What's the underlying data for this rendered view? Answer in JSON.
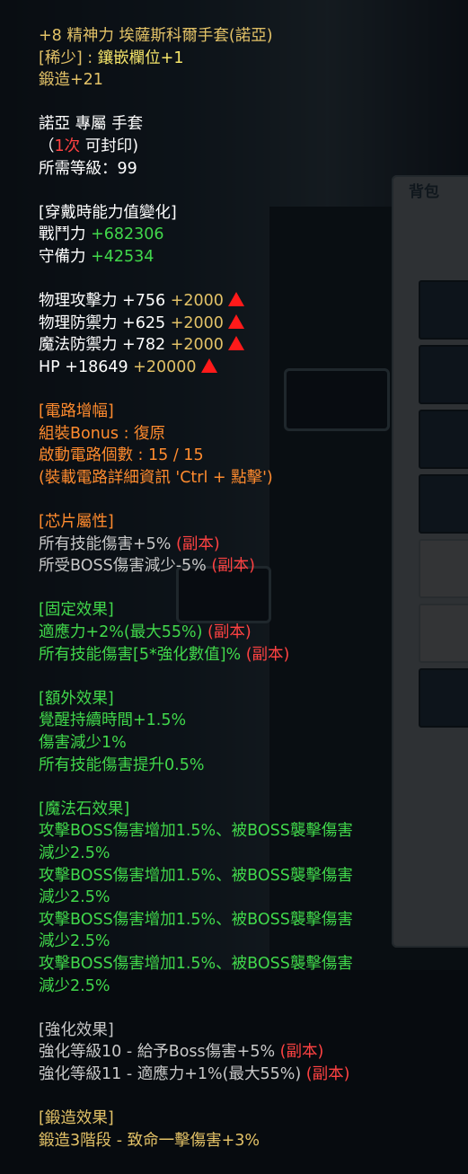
{
  "item": {
    "name": "+8 精神力 埃薩斯科爾手套(諾亞)",
    "rarity_prefix": "[稀少] : ",
    "rarity_value": "鑲嵌欄位+1",
    "forge": "鍛造+21",
    "owner_line": "諾亞 專屬 手套",
    "seal_open": "（",
    "seal_count": "1次",
    "seal_rest": " 可封印)",
    "level_req": "所需等級：99"
  },
  "equip_change": {
    "header": "[穿戴時能力值變化]",
    "rows": [
      {
        "label": "戰鬥力 ",
        "value": "+682306"
      },
      {
        "label": "守備力 ",
        "value": "+42534"
      }
    ]
  },
  "stats": [
    {
      "label": "物理攻擊力 +756 ",
      "bonus": "+2000",
      "icon": "up-arrow-icon"
    },
    {
      "label": "物理防禦力 +625 ",
      "bonus": "+2000",
      "icon": "up-arrow-icon"
    },
    {
      "label": "魔法防禦力 +782 ",
      "bonus": "+2000",
      "icon": "up-arrow-icon"
    },
    {
      "label": "HP +18649 ",
      "bonus": "+20000",
      "icon": "up-arrow-icon"
    }
  ],
  "circuit": {
    "header": "[電路增幅]",
    "lines": [
      "組裝Bonus : 復原",
      "啟動電路個數 : 15 / 15",
      "(裝載電路詳細資訊 'Ctrl + 點擊')"
    ]
  },
  "chip": {
    "header": "[芯片屬性]",
    "lines": [
      {
        "text": "所有技能傷害+5% ",
        "tag": "(副本)"
      },
      {
        "text": "所受BOSS傷害減少-5% ",
        "tag": "(副本)"
      }
    ]
  },
  "fixed": {
    "header": "[固定效果]",
    "lines": [
      {
        "text": "適應力+2%(最大55%) ",
        "tag": "(副本)"
      },
      {
        "text": "所有技能傷害[5*強化數值]% ",
        "tag": "(副本)"
      }
    ]
  },
  "extra": {
    "header": "[額外效果]",
    "lines": [
      "覺醒持續時間+1.5%",
      "傷害減少1%",
      "所有技能傷害提升0.5%"
    ]
  },
  "magic_stone": {
    "header": "[魔法石效果]",
    "lines": [
      "攻擊BOSS傷害增加1.5%、被BOSS襲擊傷害",
      "減少2.5%",
      "攻擊BOSS傷害增加1.5%、被BOSS襲擊傷害",
      "減少2.5%",
      "攻擊BOSS傷害增加1.5%、被BOSS襲擊傷害",
      "減少2.5%",
      "攻擊BOSS傷害增加1.5%、被BOSS襲擊傷害",
      "減少2.5%"
    ]
  },
  "enhance": {
    "header": "[強化效果]",
    "lines": [
      {
        "text": "強化等級10 - 給予Boss傷害+5% ",
        "tag": "(副本)"
      },
      {
        "text": "強化等級11 - 適應力+1%(最大55%) ",
        "tag": "(副本)"
      }
    ]
  },
  "forge_effect": {
    "header": "[鍛造效果]",
    "lines": [
      "鍛造3階段 - 致命一擊傷害+3%"
    ]
  },
  "background": {
    "inventory_title": "背包"
  },
  "colors": {
    "gold": "#e3c267",
    "green": "#41d84b",
    "orange": "#ff8b2e",
    "red": "#ff4242",
    "grey": "#c8c8c8"
  }
}
